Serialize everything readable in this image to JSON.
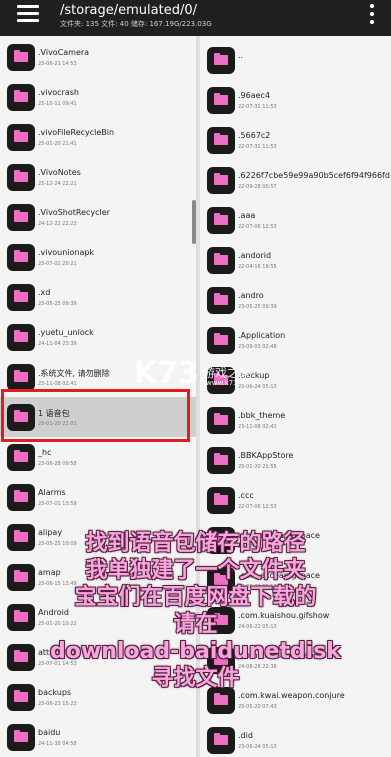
{
  "header": {
    "path": "/storage/emulated/0/",
    "stats": "文件夹: 135   文件: 40   储存: 167.19G/223.03G"
  },
  "left_items": [
    {
      "name": ".VivoCamera",
      "date": "23-06-21 14:53"
    },
    {
      "name": ".vivocrash",
      "date": "23-10-11 09:41"
    },
    {
      "name": ".vivoFileRecycleBin",
      "date": "25-01-20 21:41"
    },
    {
      "name": ".VivoNotes",
      "date": "23-12-24 22:21"
    },
    {
      "name": ".VivoShotRecycler",
      "date": "24-12-22 22:23"
    },
    {
      "name": ".vivounionapk",
      "date": "23-07-02 20:21"
    },
    {
      "name": ".xd",
      "date": "23-05-25 09:39"
    },
    {
      "name": ".yuetu_unlock",
      "date": "24-11-04 23:39"
    },
    {
      "name": ".系统文件, 请勿删除",
      "date": "23-11-08 02:41"
    },
    {
      "name": "1 语音包",
      "date": "25-01-20 22:01",
      "selected": true
    },
    {
      "name": "_hc",
      "date": "23-06-28 09:58"
    },
    {
      "name": "Alarms",
      "date": "23-07-01 13:59"
    },
    {
      "name": "alipay",
      "date": "23-05-25 10:09"
    },
    {
      "name": "amap",
      "date": "23-06-15 13:49"
    },
    {
      "name": "Android",
      "date": "25-01-20 10:22"
    },
    {
      "name": "attribution",
      "date": "23-07-01 14:53"
    },
    {
      "name": "backups",
      "date": "23-06-23 15:23"
    },
    {
      "name": "baidu",
      "date": "24-11-30 04:58"
    }
  ],
  "right_items": [
    {
      "name": "..",
      "date": ""
    },
    {
      "name": ".96aec4",
      "date": "22-07-31 11:53"
    },
    {
      "name": ".5667c2",
      "date": "22-07-31 11:53"
    },
    {
      "name": ".6226f7cbe59e99a90b5cef6f94f966fd",
      "date": "22-09-28 00:57"
    },
    {
      "name": ".aaa",
      "date": "22-07-06 12:53"
    },
    {
      "name": ".andorid",
      "date": "22-04-16 19:55"
    },
    {
      "name": ".andro",
      "date": "23-05-25 09:39"
    },
    {
      "name": ".Application",
      "date": "23-09-03 02:48"
    },
    {
      "name": ".backup",
      "date": "25-06-24 05:13"
    },
    {
      "name": ".bbk_theme",
      "date": "23-11-08 02:42"
    },
    {
      "name": ".BBKAppStore",
      "date": "25-01-20 21:55"
    },
    {
      "name": ".ccc",
      "date": "22-07-06 12:53"
    },
    {
      "name": ".com.excean.gspace",
      "date": "23-07-12 15:33"
    },
    {
      "name": ".com.excean.gspace",
      "date": "24-06-22 05:13"
    },
    {
      "name": ".com.kuaishou.gifshow",
      "date": "24-06-22 05:13"
    },
    {
      "name": ".com.kuaishou.nebula",
      "date": "24-08-28 22:38"
    },
    {
      "name": ".com.kwai.weapon.conjure",
      "date": "25-05-20 07:43"
    },
    {
      "name": ".did",
      "date": "23-06-24 05:13"
    }
  ],
  "watermark": {
    "logo": "K73",
    "text": "游戏之家",
    "url": "www.k73.com"
  },
  "overlay_lines": [
    "找到语音包储存的路径",
    "我单独建了一个文件夹",
    "宝宝们在百度网盘下载的",
    "请在",
    "download-baidunetdisk",
    "寻找文件"
  ],
  "colors": {
    "folder_accent": "#f06ec4",
    "highlight": "#e11d1d",
    "overlay_text": "#f5a7dd"
  }
}
